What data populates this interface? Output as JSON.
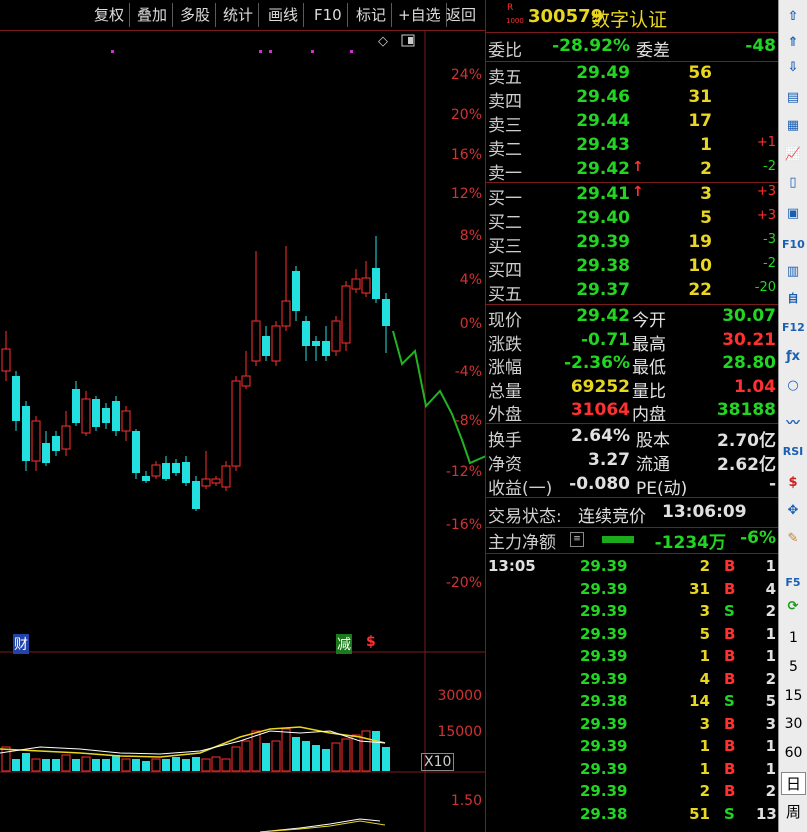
{
  "toolbar": {
    "buttons": [
      "复权",
      "叠加",
      "多股",
      "统计",
      "画线",
      "F10",
      "标记",
      "+自选",
      "返回"
    ]
  },
  "chart": {
    "pct_labels": [
      "24%",
      "20%",
      "16%",
      "12%",
      "8%",
      "4%",
      "0%",
      "-4%",
      "-8%",
      "-12%",
      "-16%",
      "-20%"
    ],
    "markers": {
      "cai": "财",
      "jian": "减",
      "s": "$"
    },
    "volume_labels": [
      "30000",
      "15000"
    ],
    "volume_unit": "X10",
    "indicator_label": "1.50"
  },
  "quote": {
    "flag_r": "R",
    "flag_1000": "1000",
    "code": "300579",
    "name": "数字认证",
    "weibi_label": "委比",
    "weibi_value": "-28.92%",
    "weicha_label": "委差",
    "weicha_value": "-48",
    "asks": [
      {
        "label": "卖五",
        "price": "29.49",
        "vol": "56",
        "chg": "",
        "arrow": ""
      },
      {
        "label": "卖四",
        "price": "29.46",
        "vol": "31",
        "chg": "",
        "arrow": ""
      },
      {
        "label": "卖三",
        "price": "29.44",
        "vol": "17",
        "chg": "",
        "arrow": ""
      },
      {
        "label": "卖二",
        "price": "29.43",
        "vol": "1",
        "chg": "+1",
        "arrow": ""
      },
      {
        "label": "卖一",
        "price": "29.42",
        "vol": "2",
        "chg": "-2",
        "arrow": "↑"
      }
    ],
    "bids": [
      {
        "label": "买一",
        "price": "29.41",
        "vol": "3",
        "chg": "+3",
        "arrow": "↑"
      },
      {
        "label": "买二",
        "price": "29.40",
        "vol": "5",
        "chg": "+3",
        "arrow": ""
      },
      {
        "label": "买三",
        "price": "29.39",
        "vol": "19",
        "chg": "-3",
        "arrow": ""
      },
      {
        "label": "买四",
        "price": "29.38",
        "vol": "10",
        "chg": "-2",
        "arrow": ""
      },
      {
        "label": "买五",
        "price": "29.37",
        "vol": "22",
        "chg": "-20",
        "arrow": ""
      }
    ],
    "stats": [
      {
        "l1": "现价",
        "v1": "29.42",
        "l2": "今开",
        "v2": "30.07"
      },
      {
        "l1": "涨跌",
        "v1": "-0.71",
        "l2": "最高",
        "v2": "30.21"
      },
      {
        "l1": "涨幅",
        "v1": "-2.36%",
        "l2": "最低",
        "v2": "28.80"
      },
      {
        "l1": "总量",
        "v1": "69252",
        "l2": "量比",
        "v2": "1.04"
      },
      {
        "l1": "外盘",
        "v1": "31064",
        "l2": "内盘",
        "v2": "38188"
      }
    ],
    "stats2": [
      {
        "l1": "换手",
        "v1": "2.64%",
        "l2": "股本",
        "v2": "2.70亿"
      },
      {
        "l1": "净资",
        "v1": "3.27",
        "l2": "流通",
        "v2": "2.62亿"
      },
      {
        "l1": "收益(一)",
        "v1": "-0.080",
        "l2": "PE(动)",
        "v2": "-"
      }
    ],
    "status_label": "交易状态:",
    "status_value": "连续竞价",
    "status_time": "13:06:09",
    "net_label": "主力净额",
    "net_value": "-1234万",
    "net_pct": "-6%",
    "ticks_time": "13:05",
    "ticks": [
      {
        "p": "29.39",
        "v": "2",
        "t": "B",
        "n": "1"
      },
      {
        "p": "29.39",
        "v": "31",
        "t": "B",
        "n": "4"
      },
      {
        "p": "29.39",
        "v": "3",
        "t": "S",
        "n": "2"
      },
      {
        "p": "29.39",
        "v": "5",
        "t": "B",
        "n": "1"
      },
      {
        "p": "29.39",
        "v": "1",
        "t": "B",
        "n": "1"
      },
      {
        "p": "29.39",
        "v": "4",
        "t": "B",
        "n": "2"
      },
      {
        "p": "29.38",
        "v": "14",
        "t": "S",
        "n": "5"
      },
      {
        "p": "29.39",
        "v": "3",
        "t": "B",
        "n": "3"
      },
      {
        "p": "29.39",
        "v": "1",
        "t": "B",
        "n": "1"
      },
      {
        "p": "29.39",
        "v": "1",
        "t": "B",
        "n": "1"
      },
      {
        "p": "29.39",
        "v": "2",
        "t": "B",
        "n": "2"
      },
      {
        "p": "29.38",
        "v": "51",
        "t": "S",
        "n": "13"
      }
    ]
  },
  "sidebar": {
    "icons": [
      "arrow-up-icon",
      "arrow-up2-icon",
      "arrow-down-icon",
      "chart-list-icon",
      "grid-icon",
      "line-chart-icon",
      "candle-icon",
      "window-icon",
      "f10-icon",
      "doc-icon",
      "zi-icon",
      "f12-icon",
      "fx-icon",
      "circle-icon",
      "wave-icon",
      "rsi-icon",
      "dollar-icon",
      "move-icon",
      "pen-icon",
      "f5-icon",
      "refresh-icon"
    ],
    "rsi": "RSI",
    "f10": "F10",
    "f12": "F12",
    "f5": "F5",
    "zi": "自",
    "periods": [
      "1",
      "5",
      "15",
      "30",
      "60"
    ],
    "day": "日",
    "week": "周"
  },
  "colors": {
    "up": "#ff3030",
    "down": "#23e0e0",
    "green": "#23d523",
    "yellow": "#e8d620"
  }
}
